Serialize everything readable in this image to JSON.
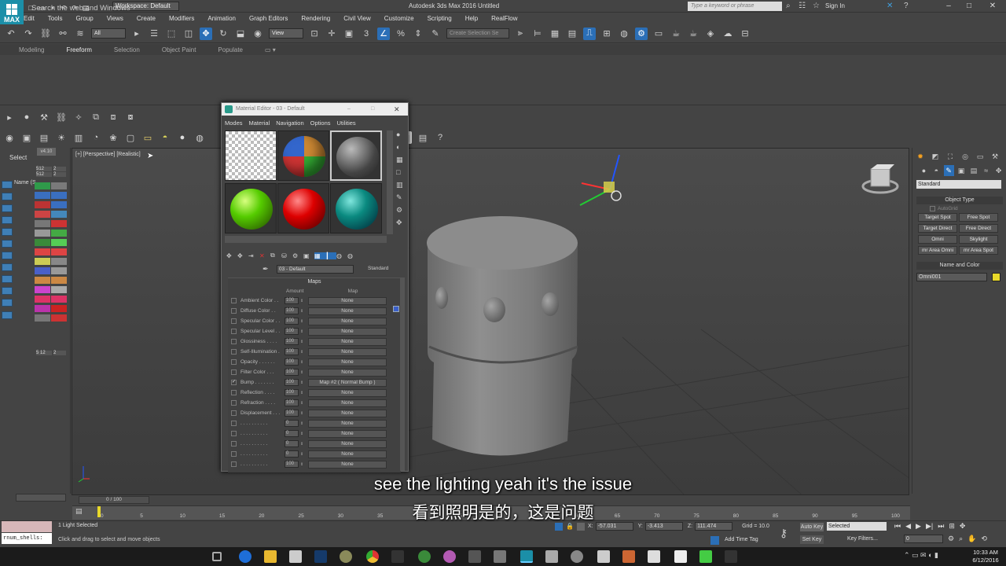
{
  "window": {
    "app_logo": "MAX",
    "workspace": "Workspace: Default",
    "title": "Autodesk 3ds Max 2016     Untitled",
    "search_placeholder": "Type a keyword or phrase",
    "sign_in": "Sign In"
  },
  "menubar": [
    "Edit",
    "Tools",
    "Group",
    "Views",
    "Create",
    "Modifiers",
    "Animation",
    "Graph Editors",
    "Rendering",
    "Civil View",
    "Customize",
    "Scripting",
    "Help",
    "RealFlow"
  ],
  "toolbar": {
    "filter_value": "All",
    "ref_coord": "View",
    "named_selection_placeholder": "Create Selection Se"
  },
  "ribbon": {
    "tabs": [
      "Modeling",
      "Freeform",
      "Selection",
      "Object Paint",
      "Populate"
    ],
    "active_tab": "Freeform"
  },
  "scene_explorer": {
    "select_label": "Select",
    "name_label": "Name (S",
    "version": "v4.10",
    "values": [
      "512",
      "2",
      "512",
      "2",
      "5 12",
      "2"
    ]
  },
  "viewport": {
    "label": "[+] [Perspective] [Realistic]"
  },
  "material_editor": {
    "title": "Material Editor - 03 - Default",
    "menu": [
      "Modes",
      "Material",
      "Navigation",
      "Options",
      "Utilities"
    ],
    "material_name": "03 - Default",
    "material_type": "Standard",
    "maps_title": "Maps",
    "col_amount": "Amount",
    "col_map": "Map",
    "rows": [
      {
        "checked": false,
        "name": "Ambient Color . .",
        "amount": "100",
        "map": "None"
      },
      {
        "checked": false,
        "name": "Diffuse Color . .",
        "amount": "100",
        "map": "None"
      },
      {
        "checked": false,
        "name": "Specular Color . .",
        "amount": "100",
        "map": "None"
      },
      {
        "checked": false,
        "name": "Specular Level . .",
        "amount": "100",
        "map": "None"
      },
      {
        "checked": false,
        "name": "Glossiness . . . .",
        "amount": "100",
        "map": "None"
      },
      {
        "checked": false,
        "name": "Self-Illumination .",
        "amount": "100",
        "map": "None"
      },
      {
        "checked": false,
        "name": "Opacity . . . . . .",
        "amount": "100",
        "map": "None"
      },
      {
        "checked": false,
        "name": "Filter Color . . .",
        "amount": "100",
        "map": "None"
      },
      {
        "checked": true,
        "name": "Bump . . . . . . .",
        "amount": "100",
        "map": "Map #2 ( Normal Bump )"
      },
      {
        "checked": false,
        "name": "Reflection . . . .",
        "amount": "100",
        "map": "None"
      },
      {
        "checked": false,
        "name": "Refraction . . . .",
        "amount": "100",
        "map": "None"
      },
      {
        "checked": false,
        "name": "Displacement . . .",
        "amount": "100",
        "map": "None"
      },
      {
        "checked": false,
        "name": ". . . . . . . . . .",
        "amount": "0",
        "map": "None"
      },
      {
        "checked": false,
        "name": ". . . . . . . . . .",
        "amount": "0",
        "map": "None"
      },
      {
        "checked": false,
        "name": ". . . . . . . . . .",
        "amount": "0",
        "map": "None"
      },
      {
        "checked": false,
        "name": ". . . . . . . . . .",
        "amount": "0",
        "map": "None"
      },
      {
        "checked": false,
        "name": ". . . . . . . . . .",
        "amount": "100",
        "map": "None"
      }
    ]
  },
  "command_panel": {
    "category": "Standard",
    "object_type_title": "Object Type",
    "autogrid": "AutoGrid",
    "buttons": [
      "Target Spot",
      "Free Spot",
      "Target Direct",
      "Free Direct",
      "Omni",
      "Skylight",
      "mr Area Omni",
      "mr Area Spot"
    ],
    "name_color_title": "Name and Color",
    "object_name": "Omni001",
    "object_color": "#e8d82a"
  },
  "timeline": {
    "slider": "0 / 100",
    "ticks": [
      "0",
      "5",
      "10",
      "15",
      "20",
      "25",
      "30",
      "35",
      "40",
      "45",
      "50",
      "55",
      "60",
      "65",
      "70",
      "75",
      "80",
      "85",
      "90",
      "95",
      "100"
    ]
  },
  "status": {
    "listener_text": "rnum_shells:",
    "selected": "1 Light Selected",
    "prompt": "Click and drag to select and move objects",
    "x_label": "X:",
    "x": "-57.031",
    "y_label": "Y:",
    "y": "-3.413",
    "z_label": "Z:",
    "z": "111.474",
    "grid": "Grid = 10.0",
    "add_time_tag": "Add Time Tag",
    "auto_key": "Auto Key",
    "set_key": "Set Key",
    "key_mode": "Selected",
    "key_filters": "Key Filters...",
    "frame": "0"
  },
  "taskbar": {
    "search": "Search the web and Windows",
    "time": "10:33 AM",
    "date": "6/12/2016"
  },
  "captions": {
    "en": "see the lighting yeah it's the issue",
    "zh": "看到照明是的，这是问题"
  }
}
